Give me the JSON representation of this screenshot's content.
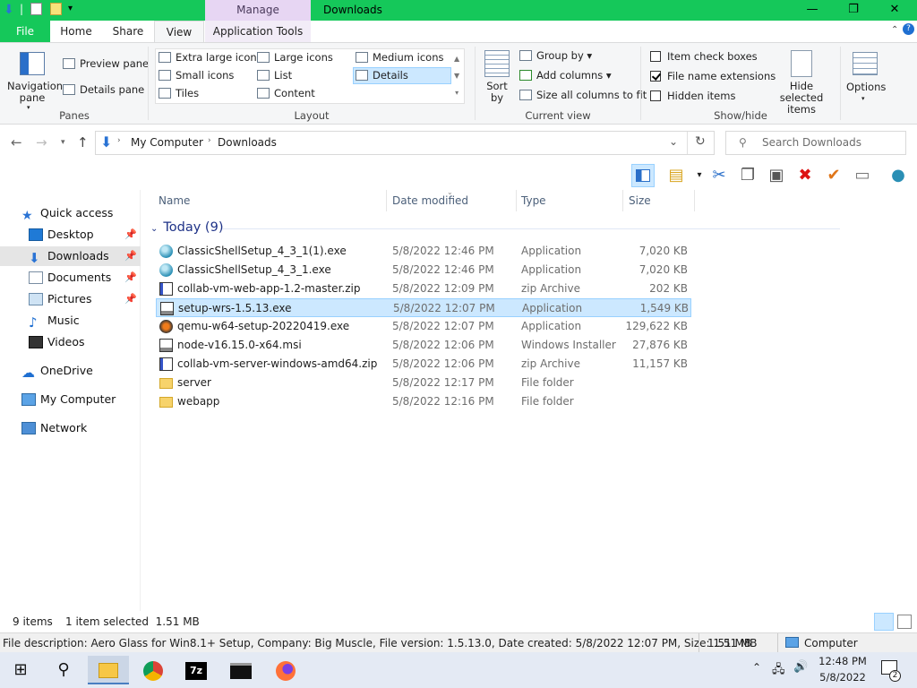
{
  "window": {
    "title": "Downloads",
    "context_tab": "Manage"
  },
  "ribbon_tabs": [
    "File",
    "Home",
    "Share",
    "View",
    "Application Tools"
  ],
  "ribbon": {
    "panes": {
      "navigation_pane": "Navigation pane",
      "preview_pane": "Preview pane",
      "details_pane": "Details pane",
      "label": "Panes"
    },
    "layout": {
      "extra_large": "Extra large icons",
      "large": "Large icons",
      "medium": "Medium icons",
      "small": "Small icons",
      "list": "List",
      "details": "Details",
      "tiles": "Tiles",
      "content": "Content",
      "label": "Layout"
    },
    "current_view": {
      "sort_by": "Sort by",
      "group_by": "Group by",
      "add_columns": "Add columns",
      "size_all": "Size all columns to fit",
      "label": "Current view"
    },
    "show_hide": {
      "item_check_boxes": "Item check boxes",
      "file_name_extensions": "File name extensions",
      "hidden_items": "Hidden items",
      "hide_selected": "Hide selected items",
      "label": "Show/hide"
    },
    "options": "Options"
  },
  "address": {
    "crumbs": [
      "My Computer",
      "Downloads"
    ],
    "search_placeholder": "Search Downloads"
  },
  "nav": {
    "quick_access": "Quick access",
    "items": [
      "Desktop",
      "Downloads",
      "Documents",
      "Pictures",
      "Music",
      "Videos"
    ],
    "onedrive": "OneDrive",
    "my_computer": "My Computer",
    "network": "Network"
  },
  "columns": [
    "Name",
    "Date modified",
    "Type",
    "Size"
  ],
  "group_header": "Today (9)",
  "files": [
    {
      "name": "ClassicShellSetup_4_3_1(1).exe",
      "date": "5/8/2022 12:46 PM",
      "type": "Application",
      "size": "7,020 KB",
      "icon": "shell-icon"
    },
    {
      "name": "ClassicShellSetup_4_3_1.exe",
      "date": "5/8/2022 12:46 PM",
      "type": "Application",
      "size": "7,020 KB",
      "icon": "shell-icon"
    },
    {
      "name": "collab-vm-web-app-1.2-master.zip",
      "date": "5/8/2022 12:09 PM",
      "type": "zip Archive",
      "size": "202 KB",
      "icon": "zip-icon"
    },
    {
      "name": "setup-wrs-1.5.13.exe",
      "date": "5/8/2022 12:07 PM",
      "type": "Application",
      "size": "1,549 KB",
      "icon": "installer-icon"
    },
    {
      "name": "qemu-w64-setup-20220419.exe",
      "date": "5/8/2022 12:07 PM",
      "type": "Application",
      "size": "129,622 KB",
      "icon": "qemu-icon"
    },
    {
      "name": "node-v16.15.0-x64.msi",
      "date": "5/8/2022 12:06 PM",
      "type": "Windows Installer ...",
      "size": "27,876 KB",
      "icon": "installer-icon"
    },
    {
      "name": "collab-vm-server-windows-amd64.zip",
      "date": "5/8/2022 12:06 PM",
      "type": "zip Archive",
      "size": "11,157 KB",
      "icon": "zip-icon"
    },
    {
      "name": "server",
      "date": "5/8/2022 12:17 PM",
      "type": "File folder",
      "size": "",
      "icon": "folder-icon"
    },
    {
      "name": "webapp",
      "date": "5/8/2022 12:16 PM",
      "type": "File folder",
      "size": "",
      "icon": "folder-icon"
    }
  ],
  "status": {
    "count": "9 items",
    "selected": "1 item selected  1.51 MB"
  },
  "detailbar": {
    "description": "File description: Aero Glass for Win8.1+ Setup, Company: Big Muscle, File version: 1.5.13.0, Date created: 5/8/2022 12:07 PM, Size: 1.51 MB",
    "size": "1.51 MB",
    "location": "Computer"
  },
  "taskbar": {
    "time": "12:48 PM",
    "date": "5/8/2022",
    "notifications": "2"
  },
  "colors": {
    "accent": "#15c85a",
    "selection": "#cce8ff"
  }
}
